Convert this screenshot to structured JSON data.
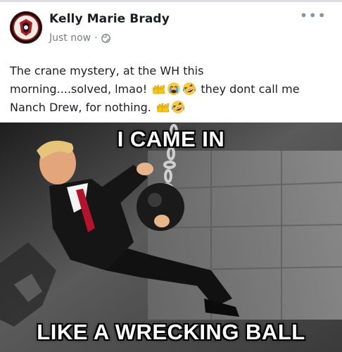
{
  "post": {
    "author": "Kelly Marie Brady",
    "timestamp": "Just now",
    "separator": "·",
    "audience_icon": "globe-icon",
    "more_label": "•••",
    "text_line1": "The crane mystery, at the WH this",
    "text_line2a": "morning....solved, lmao!",
    "text_line2b": "they dont call me",
    "text_line3": "Nanch Drew, for nothing.",
    "emojis": [
      "raising-hands-emoji",
      "crying-face-emoji",
      "rolling-laughing-emoji"
    ]
  },
  "meme": {
    "top_caption": "I CAME IN",
    "bottom_caption": "LIKE A WRECKING BALL"
  },
  "colors": {
    "text": "#1c1e21",
    "meta": "#7a7d82",
    "divider": "#dddfe2"
  }
}
